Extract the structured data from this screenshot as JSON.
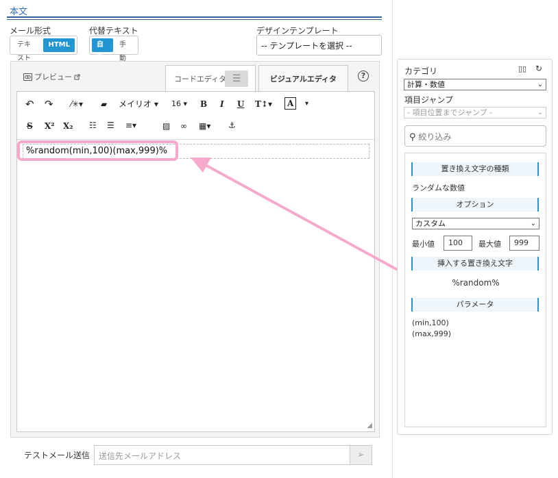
{
  "section_title": "本文",
  "mail_format": {
    "label": "メール形式",
    "options": [
      "テキスト",
      "HTML"
    ],
    "selected": "HTML"
  },
  "alt_text": {
    "label": "代替テキスト",
    "options": [
      "自動",
      "手動"
    ],
    "selected": "自動"
  },
  "design_template": {
    "label": "デザインテンプレート",
    "value": "-- テンプレートを選択 --"
  },
  "editor": {
    "preview_label": "プレビュー",
    "tab_code": "コードエディタ",
    "tab_visual": "ビジュアルエディタ",
    "help": "?",
    "toolbar": {
      "font_name": "メイリオ",
      "font_size": "16",
      "bold": "B",
      "italic": "I",
      "underline": "U",
      "text_height": "T↕",
      "text_color": "A",
      "superscript": "X²",
      "subscript": "X₂"
    },
    "content": "%random(min,100)(max,999)%"
  },
  "test_mail": {
    "label": "テストメール送信",
    "placeholder": "送信先メールアドレス"
  },
  "right_panel": {
    "category_label": "カテゴリ",
    "category_value": "計算・数値",
    "jump_label": "項目ジャンプ",
    "jump_value": "- 項目位置までジャンプ -",
    "filter_placeholder": "絞り込み",
    "type_heading": "置き換え文字の種類",
    "type_value": "ランダムな数値",
    "option_heading": "オプション",
    "option_value": "カスタム",
    "min_label": "最小値",
    "min_value": "100",
    "max_label": "最大値",
    "max_value": "999",
    "insert_heading": "挿入する置き換え文字",
    "insert_value": "%random%",
    "param_heading": "パラメータ",
    "params": [
      "(min,100)",
      "(max,999)"
    ]
  },
  "colors": {
    "accent": "#2196d3",
    "highlight": "#f6a9cc",
    "header_rule": "#2c5f94"
  }
}
